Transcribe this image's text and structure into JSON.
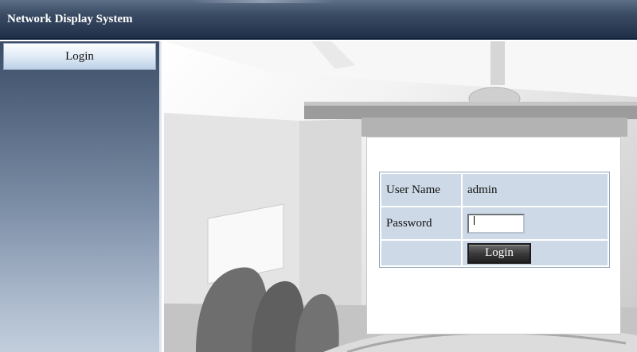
{
  "header": {
    "app_title": "Network Display System"
  },
  "sidebar": {
    "items": [
      {
        "label": "Login"
      }
    ]
  },
  "login_form": {
    "username_label": "User Name",
    "username_value": "admin",
    "password_label": "Password",
    "password_value": "",
    "submit_label": "Login"
  }
}
